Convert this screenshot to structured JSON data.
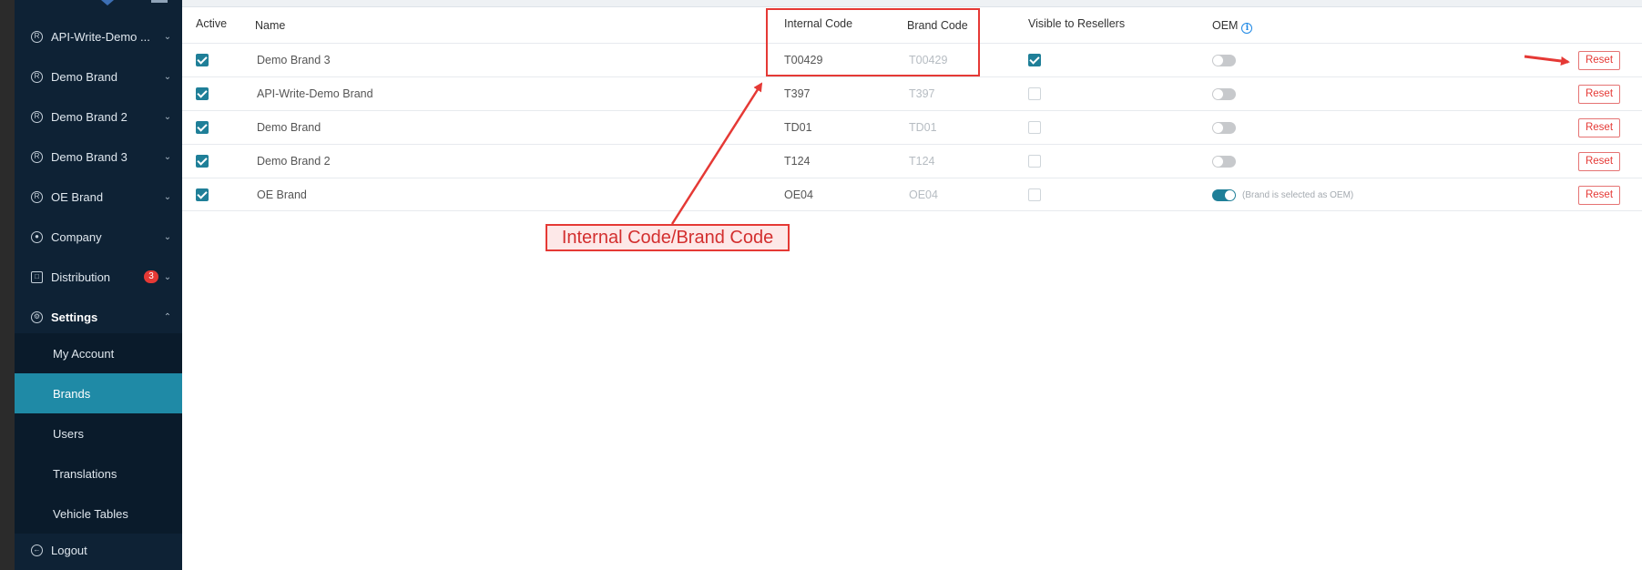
{
  "sidebar": {
    "items": [
      {
        "icon": "registered-icon",
        "label": "API-Write-Demo ...",
        "chevron": "chevron-down"
      },
      {
        "icon": "registered-icon",
        "label": "Demo Brand",
        "chevron": "chevron-down"
      },
      {
        "icon": "registered-icon",
        "label": "Demo Brand 2",
        "chevron": "chevron-down"
      },
      {
        "icon": "registered-icon",
        "label": "Demo Brand 3",
        "chevron": "chevron-down"
      },
      {
        "icon": "registered-icon",
        "label": "OE Brand",
        "chevron": "chevron-down"
      },
      {
        "icon": "globe-icon",
        "label": "Company",
        "chevron": "chevron-down"
      },
      {
        "icon": "distribution-icon",
        "label": "Distribution",
        "badge": "3",
        "chevron": "chevron-down"
      },
      {
        "icon": "gear-icon",
        "label": "Settings",
        "chevron": "chevron-up"
      }
    ],
    "settings_sub": [
      {
        "label": "My Account"
      },
      {
        "label": "Brands",
        "selected": true
      },
      {
        "label": "Users"
      },
      {
        "label": "Translations"
      },
      {
        "label": "Vehicle Tables"
      }
    ],
    "logout_label": "Logout"
  },
  "table": {
    "headers": {
      "active": "Active",
      "name": "Name",
      "internal_code": "Internal Code",
      "brand_code": "Brand Code",
      "visible": "Visible to Resellers",
      "oem": "OEM"
    },
    "rows": [
      {
        "active": true,
        "name": "Demo Brand 3",
        "internal_code": "T00429",
        "brand_code": "T00429",
        "visible": true,
        "oem": false,
        "oem_note": "",
        "reset": "Reset"
      },
      {
        "active": true,
        "name": "API-Write-Demo Brand",
        "internal_code": "T397",
        "brand_code": "T397",
        "visible": false,
        "oem": false,
        "oem_note": "",
        "reset": "Reset"
      },
      {
        "active": true,
        "name": "Demo Brand",
        "internal_code": "TD01",
        "brand_code": "TD01",
        "visible": false,
        "oem": false,
        "oem_note": "",
        "reset": "Reset"
      },
      {
        "active": true,
        "name": "Demo Brand 2",
        "internal_code": "T124",
        "brand_code": "T124",
        "visible": false,
        "oem": false,
        "oem_note": "",
        "reset": "Reset"
      },
      {
        "active": true,
        "name": "OE Brand",
        "internal_code": "OE04",
        "brand_code": "OE04",
        "visible": false,
        "oem": true,
        "oem_note": "(Brand is selected as OEM)",
        "reset": "Reset"
      }
    ]
  },
  "annotation": {
    "label": "Internal Code/Brand Code",
    "color": "#e53935"
  },
  "colors": {
    "sidebar_bg": "#0e2235",
    "accent": "#1f8aa6",
    "danger": "#e53935"
  }
}
